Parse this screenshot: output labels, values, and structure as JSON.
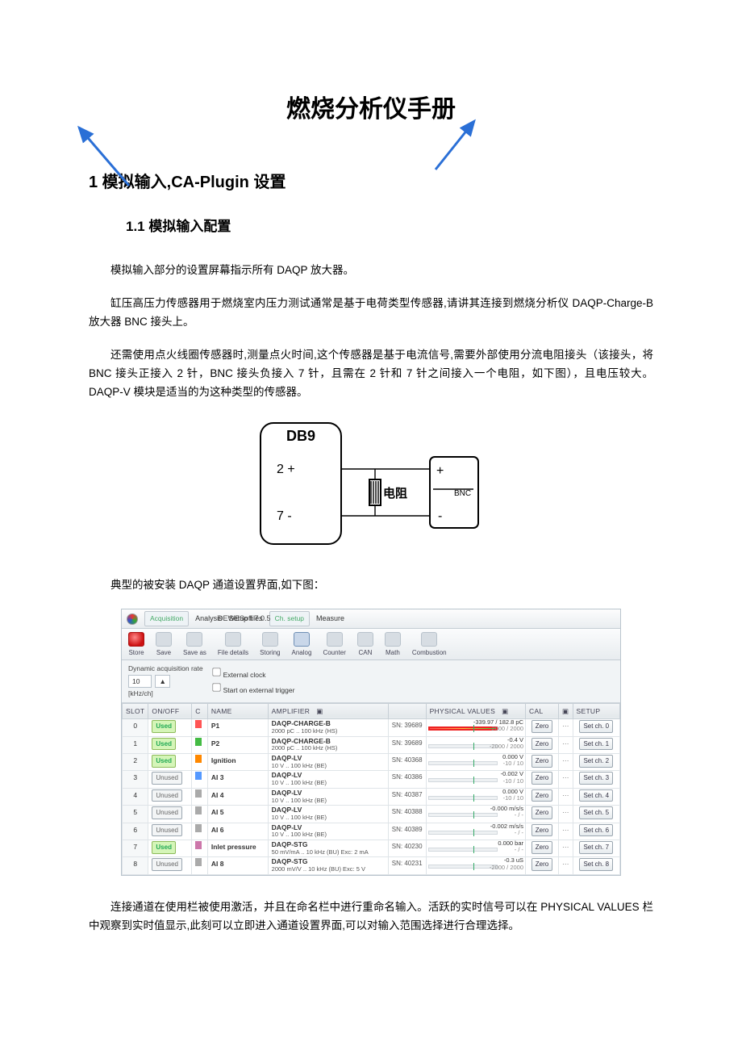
{
  "title": "燃烧分析仪手册",
  "section1": "1  模拟输入,CA-Plugin 设置",
  "section1_1": "1.1  模拟输入配置",
  "para1": "模拟输入部分的设置屏幕指示所有 DAQP 放大器。",
  "para2": "缸压高压力传感器用于燃烧室内压力测试通常是基于电荷类型传感器,请讲其连接到燃烧分析仪 DAQP-Charge-B 放大器 BNC 接头上。",
  "para3": "还需使用点火线圈传感器时,测量点火时间,这个传感器是基于电流信号,需要外部使用分流电阻接头（该接头，将 BNC 接头正接入 2 针，BNC 接头负接入 7 针，且需在 2 针和 7 针之间接入一个电阻，如下图），且电压较大。DAQP-V 模块是适当的为这种类型的传感器。",
  "diagram": {
    "db9": "DB9",
    "pin2": "2 +",
    "pin7": "7 -",
    "res": "电阻",
    "bnc": "BNC",
    "plus": "+",
    "minus": "-"
  },
  "para4": "典型的被安装 DAQP 通道设置界面,如下图：",
  "para5": "连接通道在使用栏被使用激活，并且在命名栏中进行重命名输入。活跃的实时信号可以在 PHYSICAL VALUES 栏中观察到实时值显示,此刻可以立即进入通道设置界面,可以对输入范围选择进行合理选择。",
  "shot": {
    "title": "DEWESoft 7.0.5",
    "tabs": {
      "acq": "Acquisition",
      "ana": "Analysis",
      "setup": "Setup files",
      "ch": "Ch. setup",
      "meas": "Measure"
    },
    "icons": {
      "store": "Store",
      "save": "Save",
      "saveas": "Save as",
      "file": "File details",
      "storing": "Storing",
      "analog": "Analog",
      "counter": "Counter",
      "can": "CAN",
      "math": "Math",
      "comb": "Combustion"
    },
    "dynlabel": "Dynamic acquisition rate",
    "dynval": "10",
    "dynunit": "[kHz/ch]",
    "chk1": "External clock",
    "chk2": "Start on external trigger",
    "headers": {
      "slot": "SLOT",
      "onoff": "ON/OFF",
      "c": "C",
      "name": "NAME",
      "amp": "AMPLIFIER",
      "phys": "PHYSICAL VALUES",
      "cal": "CAL",
      "setup": "SETUP"
    },
    "zero": "Zero",
    "rows": [
      {
        "i": "0",
        "on": "Used",
        "name": "P1",
        "a1": "DAQP-CHARGE-B",
        "a2": "2000 pC .. 100 kHz (HS)",
        "sn": "SN: 39689",
        "lo": "-2000",
        "hi": "2000",
        "val": "-339.97 / 182.8 pC",
        "set": "Set ch. 0"
      },
      {
        "i": "1",
        "on": "Used",
        "name": "P2",
        "a1": "DAQP-CHARGE-B",
        "a2": "2000 pC .. 100 kHz (HS)",
        "sn": "SN: 39689",
        "lo": "-2000",
        "hi": "2000",
        "val": "-0.4 V",
        "set": "Set ch. 1"
      },
      {
        "i": "2",
        "on": "Used",
        "name": "Ignition",
        "a1": "DAQP-LV",
        "a2": "10 V .. 100 kHz (BE)",
        "sn": "SN: 40368",
        "lo": "-10",
        "hi": "10",
        "val": "0.000 V",
        "set": "Set ch. 2"
      },
      {
        "i": "3",
        "on": "Unused",
        "name": "AI 3",
        "a1": "DAQP-LV",
        "a2": "10 V .. 100 kHz (BE)",
        "sn": "SN: 40386",
        "lo": "-10",
        "hi": "10",
        "val": "-0.002 V",
        "set": "Set ch. 3"
      },
      {
        "i": "4",
        "on": "Unused",
        "name": "AI 4",
        "a1": "DAQP-LV",
        "a2": "10 V .. 100 kHz (BE)",
        "sn": "SN: 40387",
        "lo": "-10",
        "hi": "10",
        "val": "0.000 V",
        "set": "Set ch. 4"
      },
      {
        "i": "5",
        "on": "Unused",
        "name": "AI 5",
        "a1": "DAQP-LV",
        "a2": "10 V .. 100 kHz (BE)",
        "sn": "SN: 40388",
        "lo": "-",
        "hi": "-",
        "val": "-0.000 m/s/s",
        "set": "Set ch. 5"
      },
      {
        "i": "6",
        "on": "Unused",
        "name": "AI 6",
        "a1": "DAQP-LV",
        "a2": "10 V .. 100 kHz (BE)",
        "sn": "SN: 40389",
        "lo": "-",
        "hi": "-",
        "val": "-0.002 m/s/s",
        "set": "Set ch. 6"
      },
      {
        "i": "7",
        "on": "Used",
        "name": "Inlet pressure",
        "a1": "DAQP-STG",
        "a2": "50 mV/mA .. 10 kHz (BU) Exc: 2 mA",
        "sn": "SN: 40230",
        "lo": "-",
        "hi": "-",
        "val": "0.000 bar",
        "set": "Set ch. 7"
      },
      {
        "i": "8",
        "on": "Unused",
        "name": "AI 8",
        "a1": "DAQP-STG",
        "a2": "2000 mV/V .. 10 kHz (BU) Exc: 5 V",
        "sn": "SN: 40231",
        "lo": "-2000",
        "hi": "2000",
        "val": "-0.3 uS",
        "set": "Set ch. 8"
      }
    ]
  }
}
